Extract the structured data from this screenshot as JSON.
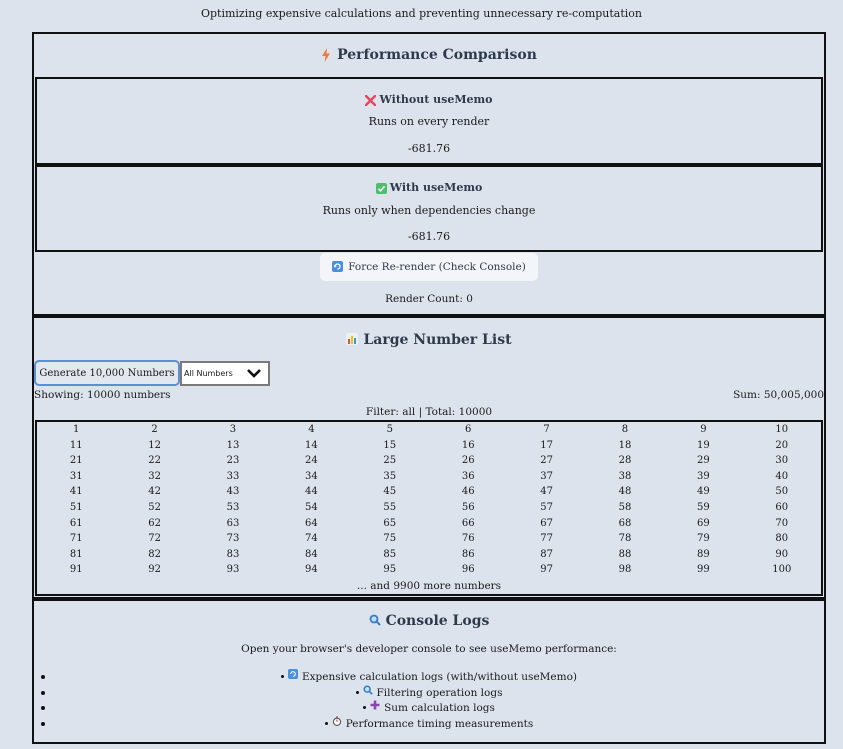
{
  "subtitle": "Optimizing expensive calculations and preventing unnecessary re-computation",
  "perf": {
    "title": "Performance Comparison",
    "without": {
      "title": "Without useMemo",
      "desc": "Runs on every render",
      "value": "-681.76"
    },
    "with": {
      "title": "With useMemo",
      "desc": "Runs only when dependencies change",
      "value": "-681.76"
    },
    "force_button": "Force Re-render (Check Console)",
    "render_count": "Render Count: 0"
  },
  "list": {
    "title": "Large Number List",
    "generate_button": "Generate 10,000 Numbers",
    "filter_selected": "All Numbers",
    "showing": "Showing: 10000 numbers",
    "sum": "Sum: 50,005,000",
    "filter_total": "Filter: all | Total: 10000",
    "numbers": [
      "1",
      "2",
      "3",
      "4",
      "5",
      "6",
      "7",
      "8",
      "9",
      "10",
      "11",
      "12",
      "13",
      "14",
      "15",
      "16",
      "17",
      "18",
      "19",
      "20",
      "21",
      "22",
      "23",
      "24",
      "25",
      "26",
      "27",
      "28",
      "29",
      "30",
      "31",
      "32",
      "33",
      "34",
      "35",
      "36",
      "37",
      "38",
      "39",
      "40",
      "41",
      "42",
      "43",
      "44",
      "45",
      "46",
      "47",
      "48",
      "49",
      "50",
      "51",
      "52",
      "53",
      "54",
      "55",
      "56",
      "57",
      "58",
      "59",
      "60",
      "61",
      "62",
      "63",
      "64",
      "65",
      "66",
      "67",
      "68",
      "69",
      "70",
      "71",
      "72",
      "73",
      "74",
      "75",
      "76",
      "77",
      "78",
      "79",
      "80",
      "81",
      "82",
      "83",
      "84",
      "85",
      "86",
      "87",
      "88",
      "89",
      "90",
      "91",
      "92",
      "93",
      "94",
      "95",
      "96",
      "97",
      "98",
      "99",
      "100"
    ],
    "more": "... and 9900 more numbers"
  },
  "logs": {
    "title": "Console Logs",
    "intro": "Open your browser's developer console to see useMemo performance:",
    "items": [
      {
        "icon": "refresh-icon",
        "text": "Expensive calculation logs (with/without useMemo)"
      },
      {
        "icon": "magnifier-icon",
        "text": "Filtering operation logs"
      },
      {
        "icon": "plus-icon",
        "text": "Sum calculation logs"
      },
      {
        "icon": "stopwatch-icon",
        "text": "Performance timing measurements"
      }
    ]
  },
  "colors": {
    "background": "#dde3ec",
    "focus_border": "#5b8fd6",
    "lightning": "#f07a3c",
    "cross": "#e8455f",
    "check": "#4cbf6b",
    "refresh": "#4a90e2",
    "plus": "#8e44ad"
  }
}
